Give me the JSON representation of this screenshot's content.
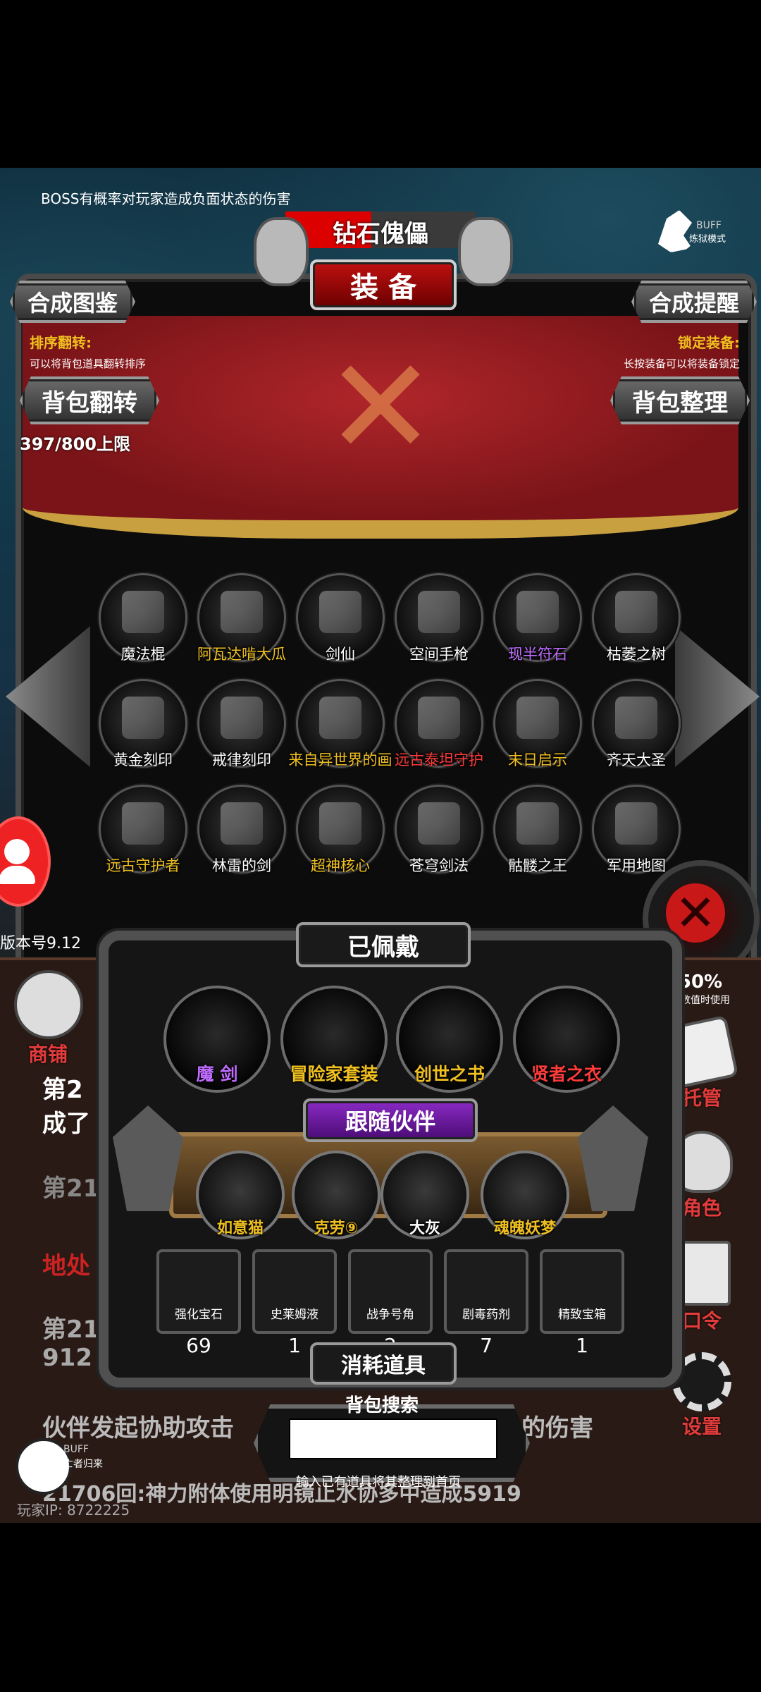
{
  "banner_text": "BOSS有概率对玩家造成负面状态的伤害",
  "boss_name": "钻石傀儡",
  "panel_title": "装 备",
  "buff_badge": {
    "top": "BUFF",
    "bottom": "炼狱模式"
  },
  "buttons": {
    "synthesis_catalog": "合成图鉴",
    "synthesis_reminder": "合成提醒",
    "bag_flip": "背包翻转",
    "bag_sort": "背包整理"
  },
  "left_hint": {
    "title": "排序翻转:",
    "desc": "可以将背包道具翻转排序"
  },
  "right_hint": {
    "title": "锁定装备:",
    "desc": "长按装备可以将装备锁定"
  },
  "capacity": "397/800上限",
  "inventory": [
    {
      "name": "魔法棍",
      "color": "#ffffff",
      "icon": "staff-icon"
    },
    {
      "name": "阿瓦达啃大瓜",
      "color": "#f0c020",
      "icon": "wand-icon"
    },
    {
      "name": "剑仙",
      "color": "#ffffff",
      "icon": "sword-sage-icon"
    },
    {
      "name": "空间手枪",
      "color": "#ffffff",
      "icon": "pistol-icon"
    },
    {
      "name": "现半符石",
      "color": "#c06cff",
      "icon": "rune-stone-icon"
    },
    {
      "name": "枯萎之树",
      "color": "#ffffff",
      "icon": "withered-tree-icon"
    },
    {
      "name": "黄金刻印",
      "color": "#ffffff",
      "icon": "gold-seal-icon"
    },
    {
      "name": "戒律刻印",
      "color": "#ffffff",
      "icon": "discipline-seal-icon"
    },
    {
      "name": "来自异世界的画",
      "color": "#f0c020",
      "icon": "painting-icon"
    },
    {
      "name": "远古泰坦守护",
      "color": "#ff3b3b",
      "icon": "titan-icon"
    },
    {
      "name": "末日启示",
      "color": "#f0c020",
      "icon": "doom-axe-icon"
    },
    {
      "name": "齐天大圣",
      "color": "#ffffff",
      "icon": "monkey-king-icon"
    },
    {
      "name": "远古守护者",
      "color": "#f0c020",
      "icon": "ancient-guardian-icon"
    },
    {
      "name": "林雷的剑",
      "color": "#ffffff",
      "icon": "blue-sword-icon"
    },
    {
      "name": "超神核心",
      "color": "#f0c020",
      "icon": "core-icon"
    },
    {
      "name": "苍穹剑法",
      "color": "#ffffff",
      "icon": "scroll-icon"
    },
    {
      "name": "骷髅之王",
      "color": "#ffffff",
      "icon": "skeleton-king-icon"
    },
    {
      "name": "军用地图",
      "color": "#ffffff",
      "icon": "map-icon"
    }
  ],
  "version": "版本号9.12",
  "worn_title": "已佩戴",
  "worn": [
    {
      "name": "魔 剑",
      "color": "#c06cff"
    },
    {
      "name": "冒险家套装",
      "color": "#f0c020"
    },
    {
      "name": "创世之书",
      "color": "#f0c020"
    },
    {
      "name": "贤者之衣",
      "color": "#ff3b3b"
    }
  ],
  "companion_title": "跟随伙伴",
  "companions": [
    {
      "name": "如意猫",
      "color": "#f0c020"
    },
    {
      "name": "克劳⑨",
      "color": "#f0c020"
    },
    {
      "name": "大灰",
      "color": "#ffffff"
    },
    {
      "name": "魂魄妖梦",
      "color": "#f0c020"
    }
  ],
  "consumables": [
    {
      "name": "强化宝石",
      "count": "69"
    },
    {
      "name": "史莱姆液",
      "count": "1"
    },
    {
      "name": "战争号角",
      "count": "2"
    },
    {
      "name": "剧毒药剂",
      "count": "7"
    },
    {
      "name": "精致宝箱",
      "count": "1"
    }
  ],
  "consumables_title": "消耗道具",
  "search": {
    "title": "背包搜索",
    "hint": "输入已有道具将其整理到首页",
    "value": ""
  },
  "side": {
    "shop": "商铺",
    "manage": "托管",
    "role": "角色",
    "command": "口令",
    "settings": "设置",
    "right_small": "其数值时使用",
    "right_count": "50%"
  },
  "log_lines": [
    "第2",
    "成了",
    "第21",
    "地处",
    "第21",
    "912",
    "伙伴发起协助攻击",
    "的伤害",
    "21706回:神力附体使用明镜止水协多中造成5919"
  ],
  "bottom_badge": {
    "top": "BUFF",
    "bottom": "亡者归来"
  },
  "player_ip": "玩家IP: 8722225"
}
